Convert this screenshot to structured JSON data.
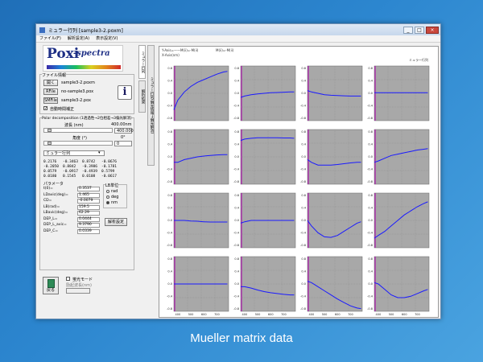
{
  "window": {
    "title": "ミュラー行列 [sample3-2.poxm]",
    "minimize": "_",
    "maximize": "□",
    "close": "×"
  },
  "menu": [
    "ファイル(F)",
    "解析設定(A)",
    "表示設定(V)"
  ],
  "logo": {
    "main": "Poxi",
    "sub": "-spectra"
  },
  "file_info": {
    "legend": "ファイル情報",
    "open_label": "開く",
    "open_value": "sample3-2.poxm",
    "ref_label": "RFile",
    "ref_value": "no-sample3.pox",
    "smf_label": "SMFile",
    "smf_value": "sample3-2.pox",
    "auto_correct": "自動時間補正",
    "info_icon": "i"
  },
  "polar": {
    "legend": "Polar decomposition (1透過性→2位相差→3偏光解消)",
    "wavelength_label": "波長 (nm)",
    "wavelength_value": "400.000",
    "wavelength_display": "400.00nm",
    "angle_label": "角度 (°)",
    "angle_value": "0",
    "angle_display": "0°",
    "select_value": "ミュラー行列",
    "matrix": [
      [
        "0.2176",
        "-0.3463",
        "0.8742",
        "-0.0676"
      ],
      [
        "-0.2050",
        "0.8842",
        "-0.3986",
        "-0.1781"
      ],
      [
        "0.0579",
        "-0.0917",
        "-0.4939",
        "0.5799"
      ],
      [
        "0.0180",
        "0.1545",
        "0.0108",
        "-0.0617"
      ]
    ],
    "params_label": "パラメータ",
    "params": [
      {
        "name": "t(0)=",
        "value": "0.3537"
      },
      {
        "name": "LDavic(deg)=",
        "value": "1.465"
      },
      {
        "name": "CD=",
        "value": "-0.0079"
      },
      {
        "name": "LB(rad)=",
        "value": "159.5"
      },
      {
        "name": "LBavic(deg)=",
        "value": "62.29"
      },
      {
        "name": "DEP_L=",
        "value": "0.0444"
      },
      {
        "name": "DEP_L_avic=",
        "value": "9.3790"
      },
      {
        "name": "DEP_C=",
        "value": "0.0339"
      }
    ],
    "lb_unit_label": "LB単位",
    "lb_units": [
      "rad",
      "deg",
      "nm"
    ],
    "lb_selected": "nm",
    "analyze_button": "解析設定"
  },
  "polarized_mode": {
    "label": "蛍光モード",
    "sub": "励起波長(nm)"
  },
  "back_button": "戻る",
  "tabs": [
    "ミュラー行列",
    "解析結果",
    "ミュラー行列(偏光情報→偏光解消)"
  ],
  "plot_header": {
    "line1": "Y-Axis=——M(ii)=-M(ii)",
    "line2": "M(ii)=-M(ii)",
    "line3": "X-Axis(nm)",
    "right": "ミュラー行列"
  },
  "x_ticks": [
    "400",
    "500",
    "600",
    "700"
  ],
  "chart_data": {
    "type": "line",
    "title": "",
    "xlabel": "",
    "ylabel": "",
    "x": [
      370,
      400,
      450,
      500,
      550,
      600,
      650,
      700,
      750,
      780
    ],
    "cells": [
      {
        "row": 1,
        "col": 1,
        "ylim": [
          -1,
          1
        ],
        "y": [
          -0.6,
          -0.25,
          0.05,
          0.25,
          0.4,
          0.5,
          0.6,
          0.7,
          0.78,
          0.8
        ]
      },
      {
        "row": 1,
        "col": 2,
        "ylim": [
          -1,
          1
        ],
        "y": [
          -0.15,
          -0.1,
          -0.05,
          -0.02,
          0.0,
          0.02,
          0.03,
          0.04,
          0.05,
          0.05
        ]
      },
      {
        "row": 1,
        "col": 3,
        "ylim": [
          -1,
          1
        ],
        "y": [
          0.1,
          0.05,
          0.0,
          -0.05,
          -0.07,
          -0.08,
          -0.09,
          -0.1,
          -0.1,
          -0.1
        ]
      },
      {
        "row": 1,
        "col": 4,
        "ylim": [
          -1,
          1
        ],
        "y": [
          0.02,
          0.02,
          0.02,
          0.02,
          0.02,
          0.02,
          0.02,
          0.02,
          0.02,
          0.02
        ]
      },
      {
        "row": 2,
        "col": 1,
        "ylim": [
          -1,
          1
        ],
        "y": [
          -0.2,
          -0.2,
          -0.1,
          -0.05,
          0.0,
          0.03,
          0.05,
          0.07,
          0.08,
          0.08
        ]
      },
      {
        "row": 2,
        "col": 2,
        "ylim": [
          -1,
          1
        ],
        "y": [
          0.6,
          0.65,
          0.68,
          0.7,
          0.7,
          0.7,
          0.7,
          0.69,
          0.69,
          0.68
        ]
      },
      {
        "row": 2,
        "col": 3,
        "ylim": [
          -1,
          1
        ],
        "y": [
          -0.1,
          -0.2,
          -0.3,
          -0.3,
          -0.3,
          -0.28,
          -0.25,
          -0.22,
          -0.2,
          -0.2
        ]
      },
      {
        "row": 2,
        "col": 4,
        "ylim": [
          -1,
          1
        ],
        "y": [
          -0.2,
          -0.15,
          -0.05,
          0.05,
          0.1,
          0.15,
          0.2,
          0.25,
          0.28,
          0.3
        ]
      },
      {
        "row": 3,
        "col": 1,
        "ylim": [
          -1,
          1
        ],
        "y": [
          0.0,
          0.0,
          0.0,
          -0.02,
          -0.03,
          -0.05,
          -0.06,
          -0.06,
          -0.06,
          -0.06
        ]
      },
      {
        "row": 3,
        "col": 2,
        "ylim": [
          -1,
          1
        ],
        "y": [
          -0.1,
          -0.05,
          0.0,
          0.0,
          0.0,
          0.0,
          0.0,
          0.0,
          0.0,
          0.0
        ]
      },
      {
        "row": 3,
        "col": 3,
        "ylim": [
          -1,
          1
        ],
        "y": [
          0.0,
          -0.2,
          -0.45,
          -0.6,
          -0.62,
          -0.55,
          -0.4,
          -0.25,
          -0.1,
          -0.05
        ]
      },
      {
        "row": 3,
        "col": 4,
        "ylim": [
          -1,
          1
        ],
        "y": [
          -0.65,
          -0.55,
          -0.4,
          -0.2,
          0.0,
          0.2,
          0.35,
          0.5,
          0.62,
          0.68
        ]
      },
      {
        "row": 4,
        "col": 1,
        "ylim": [
          -1,
          1
        ],
        "y": [
          0.0,
          0.0,
          0.0,
          0.0,
          0.0,
          0.0,
          0.0,
          0.0,
          0.0,
          0.0
        ]
      },
      {
        "row": 4,
        "col": 2,
        "ylim": [
          -1,
          1
        ],
        "y": [
          -0.1,
          -0.1,
          -0.15,
          -0.22,
          -0.28,
          -0.32,
          -0.35,
          -0.38,
          -0.4,
          -0.4
        ]
      },
      {
        "row": 4,
        "col": 3,
        "ylim": [
          -1,
          1
        ],
        "y": [
          0.1,
          0.05,
          -0.1,
          -0.25,
          -0.4,
          -0.55,
          -0.68,
          -0.8,
          -0.88,
          -0.9
        ]
      },
      {
        "row": 4,
        "col": 4,
        "ylim": [
          -1,
          1
        ],
        "y": [
          0.05,
          0.0,
          -0.2,
          -0.4,
          -0.5,
          -0.5,
          -0.45,
          -0.35,
          -0.25,
          -0.2
        ]
      }
    ],
    "y_ticks": [
      "0.8",
      "0.4",
      "0.0",
      "-0.4",
      "-0.8"
    ],
    "line_color": "#1a1aff",
    "panel_color": "#a8a8a8"
  },
  "caption": "Mueller matrix data"
}
